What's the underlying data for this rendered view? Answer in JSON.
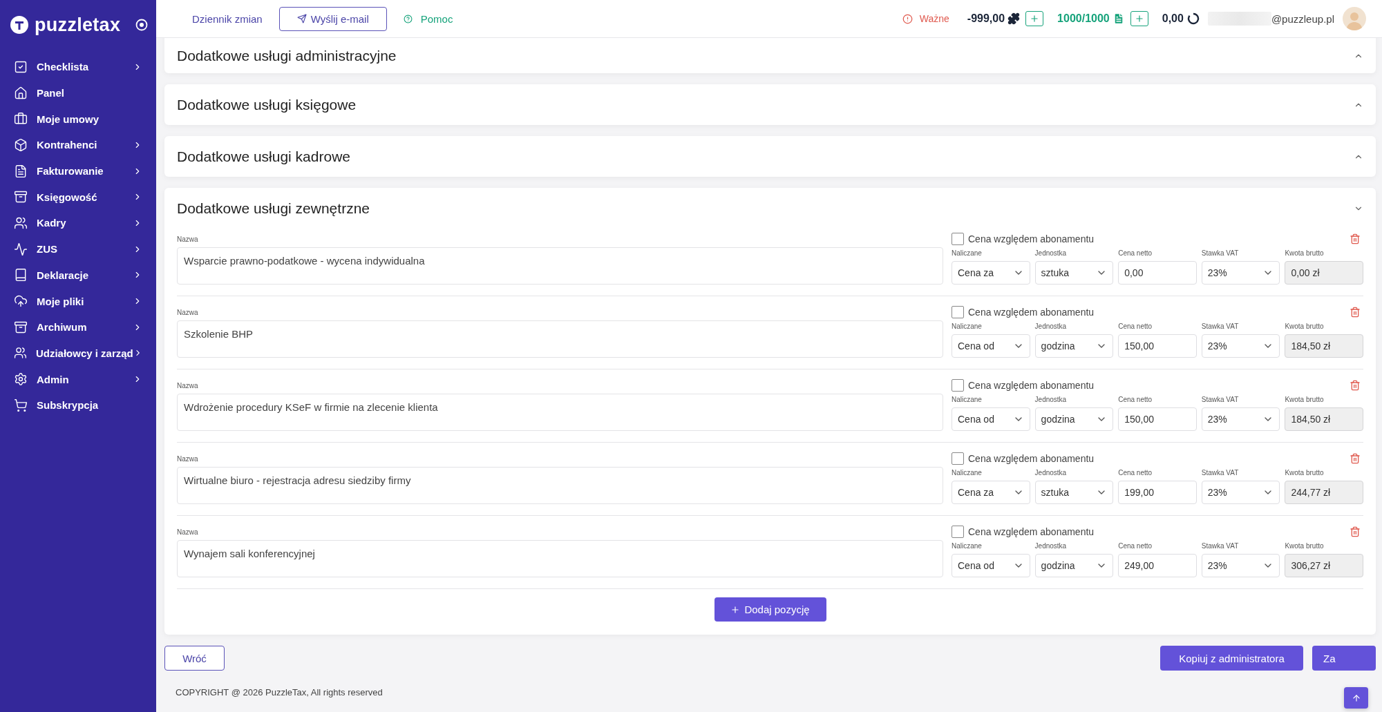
{
  "sidebar": {
    "logo": "puzzletax",
    "items": [
      {
        "label": "Checklista",
        "has_submenu": true
      },
      {
        "label": "Panel",
        "has_submenu": false
      },
      {
        "label": "Moje umowy",
        "has_submenu": false
      },
      {
        "label": "Kontrahenci",
        "has_submenu": true
      },
      {
        "label": "Fakturowanie",
        "has_submenu": true
      },
      {
        "label": "Księgowość",
        "has_submenu": true
      },
      {
        "label": "Kadry",
        "has_submenu": true
      },
      {
        "label": "ZUS",
        "has_submenu": true
      },
      {
        "label": "Deklaracje",
        "has_submenu": true
      },
      {
        "label": "Moje pliki",
        "has_submenu": true
      },
      {
        "label": "Archiwum",
        "has_submenu": true
      },
      {
        "label": "Udziałowcy i zarząd",
        "has_submenu": true
      },
      {
        "label": "Admin",
        "has_submenu": true
      },
      {
        "label": "Subskrypcja",
        "has_submenu": false
      }
    ]
  },
  "header": {
    "nav": [
      {
        "label": "Dziennik zmian",
        "kind": "link"
      },
      {
        "label": "Wyślij e-mail",
        "kind": "button"
      },
      {
        "label": "Pomoc",
        "kind": "help"
      }
    ],
    "alert": "Ważne",
    "credits": "-999,00",
    "documents": "1000/1000",
    "balance": "0,00",
    "email": "@puzzleup.pl"
  },
  "sections": [
    {
      "title": "Dodatkowe usługi administracyjne",
      "expanded": false
    },
    {
      "title": "Dodatkowe usługi księgowe",
      "expanded": false
    },
    {
      "title": "Dodatkowe usługi kadrowe",
      "expanded": false
    },
    {
      "title": "Dodatkowe usługi zewnętrzne",
      "expanded": true,
      "add_button": "Dodaj pozycję",
      "rows": [
        {
          "name_label": "Nazwa",
          "name": "Wsparcie prawno-podatkowe - wycena indywidualna",
          "checkbox_label": "Cena względem abonamentu",
          "checked": false,
          "fields": [
            {
              "label": "Naliczane",
              "value": "Cena za",
              "kind": "select"
            },
            {
              "label": "Jednostka",
              "value": "sztuka",
              "kind": "select"
            },
            {
              "label": "Cena netto",
              "value": "0,00",
              "kind": "input"
            },
            {
              "label": "Stawka VAT",
              "value": "23%",
              "kind": "select"
            },
            {
              "label": "Kwota brutto",
              "value": "0,00 zł",
              "kind": "readonly"
            }
          ]
        },
        {
          "name_label": "Nazwa",
          "name": "Szkolenie BHP",
          "checkbox_label": "Cena względem abonamentu",
          "checked": false,
          "fields": [
            {
              "label": "Naliczane",
              "value": "Cena od",
              "kind": "select"
            },
            {
              "label": "Jednostka",
              "value": "godzina",
              "kind": "select"
            },
            {
              "label": "Cena netto",
              "value": "150,00",
              "kind": "input"
            },
            {
              "label": "Stawka VAT",
              "value": "23%",
              "kind": "select"
            },
            {
              "label": "Kwota brutto",
              "value": "184,50 zł",
              "kind": "readonly"
            }
          ]
        },
        {
          "name_label": "Nazwa",
          "name": "Wdrożenie procedury KSeF w firmie na zlecenie klienta",
          "checkbox_label": "Cena względem abonamentu",
          "checked": false,
          "fields": [
            {
              "label": "Naliczane",
              "value": "Cena od",
              "kind": "select"
            },
            {
              "label": "Jednostka",
              "value": "godzina",
              "kind": "select"
            },
            {
              "label": "Cena netto",
              "value": "150,00",
              "kind": "input"
            },
            {
              "label": "Stawka VAT",
              "value": "23%",
              "kind": "select"
            },
            {
              "label": "Kwota brutto",
              "value": "184,50 zł",
              "kind": "readonly"
            }
          ]
        },
        {
          "name_label": "Nazwa",
          "name": "Wirtualne biuro - rejestracja adresu siedziby firmy",
          "checkbox_label": "Cena względem abonamentu",
          "checked": false,
          "fields": [
            {
              "label": "Naliczane",
              "value": "Cena za",
              "kind": "select"
            },
            {
              "label": "Jednostka",
              "value": "sztuka",
              "kind": "select"
            },
            {
              "label": "Cena netto",
              "value": "199,00",
              "kind": "input"
            },
            {
              "label": "Stawka VAT",
              "value": "23%",
              "kind": "select"
            },
            {
              "label": "Kwota brutto",
              "value": "244,77 zł",
              "kind": "readonly"
            }
          ]
        },
        {
          "name_label": "Nazwa",
          "name": "Wynajem sali konferencyjnej",
          "checkbox_label": "Cena względem abonamentu",
          "checked": false,
          "fields": [
            {
              "label": "Naliczane",
              "value": "Cena od",
              "kind": "select"
            },
            {
              "label": "Jednostka",
              "value": "godzina",
              "kind": "select"
            },
            {
              "label": "Cena netto",
              "value": "249,00",
              "kind": "input"
            },
            {
              "label": "Stawka VAT",
              "value": "23%",
              "kind": "select"
            },
            {
              "label": "Kwota brutto",
              "value": "306,27 zł",
              "kind": "readonly"
            }
          ]
        }
      ]
    }
  ],
  "actions": {
    "back": "Wróć",
    "copy": "Kopiuj z administratora",
    "save": "Za"
  },
  "footer": "COPYRIGHT @ 2026 PuzzleTax, All rights reserved"
}
